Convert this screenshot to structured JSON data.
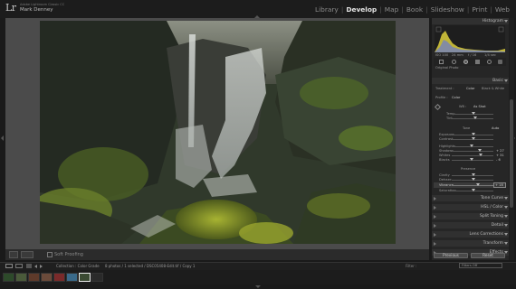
{
  "app": {
    "logo": "Lr",
    "name": "Adobe Lightroom Classic CC",
    "user": "Mark Denney"
  },
  "modules": [
    "Library",
    "Develop",
    "Map",
    "Book",
    "Slideshow",
    "Print",
    "Web"
  ],
  "active_module": "Develop",
  "toolbar": {
    "soft_proofing": "Soft Proofing"
  },
  "right_panel": {
    "histogram_title": "Histogram",
    "histogram_readout": [
      "ISO 100",
      "24 mm",
      "f / 16",
      "1/4 sec"
    ],
    "original_photo": "Original Photo",
    "basic_title": "Basic",
    "treatment_label": "Treatment :",
    "treatment_options": [
      "Color",
      "Black & White"
    ],
    "profile_label": "Profile :",
    "profile_value": "Color",
    "wb_label": "WB :",
    "wb_value": "As Shot",
    "temp_label": "Temp",
    "tint_label": "Tint",
    "tone_label": "Tone",
    "auto_label": "Auto",
    "exposure_label": "Exposure",
    "contrast_label": "Contrast",
    "highlights_label": "Highlights",
    "shadows_label": "Shadows",
    "shadows_value": "+ 27",
    "whites_label": "Whites",
    "whites_value": "+ 31",
    "blacks_label": "Blacks",
    "blacks_value": "- 6",
    "presence_label": "Presence",
    "clarity_label": "Clarity",
    "dehaze_label": "Dehaze",
    "vibrance_label": "Vibrance",
    "vibrance_value": "+ 18",
    "saturation_label": "Saturation",
    "sections": [
      "Tone Curve",
      "HSL / Color",
      "Split Toning",
      "Detail",
      "Lens Corrections",
      "Transform",
      "Effects"
    ],
    "previous_button": "Previous",
    "reset_button": "Reset"
  },
  "filmstrip": {
    "collection": "Collection : Color Grade",
    "selection": "8 photos / 1 selected / DSC05408-Edit.tif / Copy 1",
    "filter_label": "Filter :",
    "filter_value": "Filters Off"
  },
  "colors": {
    "background": "#1a1a1a",
    "panel": "#262626",
    "work_area": "#4b4b4b",
    "active_text": "#e6e6e6"
  }
}
